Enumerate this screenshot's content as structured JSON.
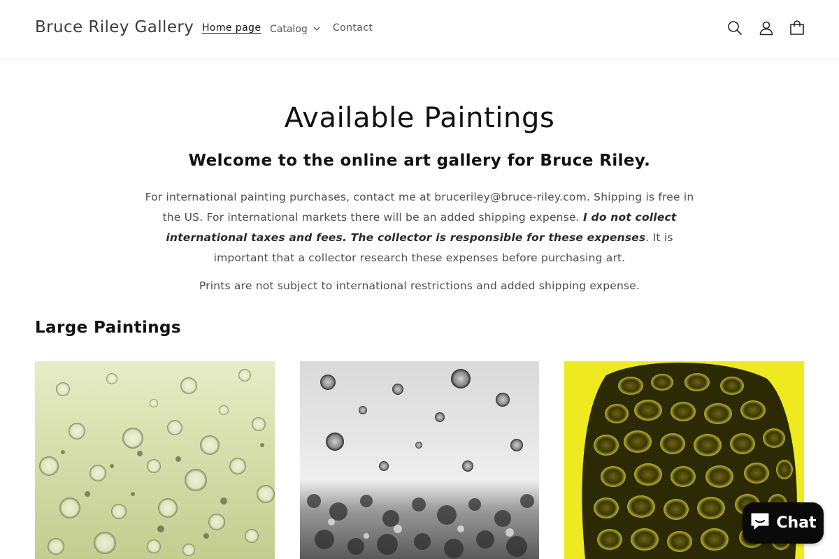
{
  "header": {
    "brand": "Bruce Riley Gallery",
    "nav": {
      "home": "Home page",
      "catalog": "Catalog",
      "contact": "Contact"
    }
  },
  "hero": {
    "title": "Available Paintings",
    "subtitle": "Welcome to the online art gallery for Bruce Riley.",
    "intro_part1": "For international painting purchases, contact me at bruceriley@bruce-riley.com. Shipping is free in the US. For international markets there will be an added shipping expense. ",
    "intro_bold": "I do not collect international taxes and fees. The collector is responsible for these expenses",
    "intro_part2": ". It is important that a collector research these expenses before purchasing art.",
    "prints_note": "Prints are not subject to international restrictions and added shipping expense."
  },
  "section": {
    "title": "Large Paintings"
  },
  "chat": {
    "label": "Chat"
  },
  "colors": {
    "accent": "#121212",
    "painting1": "#d9e0b0",
    "painting2": "#e8e8e8",
    "painting3": "#f0ec1e"
  },
  "icons": [
    "search-icon",
    "account-icon",
    "cart-icon",
    "chevron-down-icon",
    "chat-icon"
  ]
}
